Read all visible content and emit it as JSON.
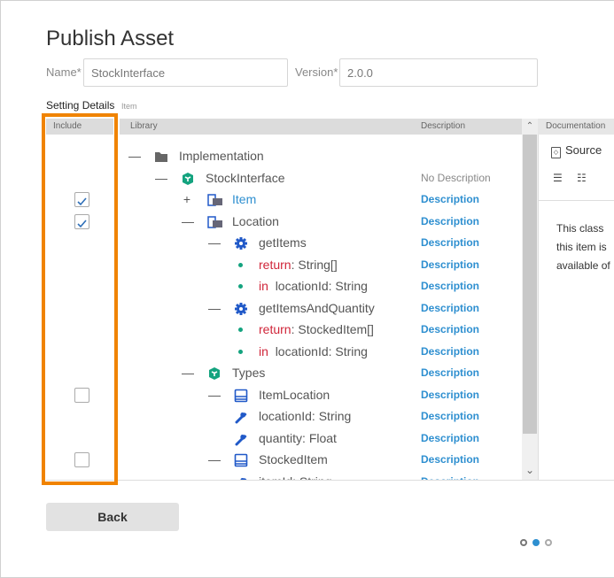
{
  "title": "Publish Asset",
  "form": {
    "name_label": "Name*",
    "name_value": "StockInterface",
    "version_label": "Version*",
    "version_value": "2.0.0"
  },
  "section": {
    "title": "Setting Details",
    "subtitle": "Item"
  },
  "columns": {
    "include": "Include",
    "library": "Library",
    "description": "Description",
    "documentation": "Documentation"
  },
  "tree": [
    {
      "level": 0,
      "toggle": "minus",
      "icon": "folder-icon",
      "label": "Implementation",
      "desc": "",
      "checkbox": null
    },
    {
      "level": 1,
      "toggle": "minus",
      "icon": "package-icon",
      "label": "StockInterface",
      "desc": "No Description",
      "checkbox": null
    },
    {
      "level": 2,
      "toggle": "plus",
      "icon": "class-icon",
      "label": "Item",
      "desc": "Description",
      "checkbox": true,
      "highlight": true
    },
    {
      "level": 2,
      "toggle": "minus",
      "icon": "class-icon",
      "label": "Location",
      "desc": "Description",
      "checkbox": true
    },
    {
      "level": 3,
      "toggle": "minus",
      "icon": "gear-icon",
      "label": "getItems",
      "desc": "Description",
      "checkbox": null
    },
    {
      "level": 4,
      "toggle": "bullet",
      "prefix": "return",
      "label": ": String[]",
      "desc": "Description",
      "checkbox": null
    },
    {
      "level": 4,
      "toggle": "bullet",
      "prefix": "in",
      "label": "locationId: String",
      "desc": "Description",
      "checkbox": null
    },
    {
      "level": 3,
      "toggle": "minus",
      "icon": "gear-icon",
      "label": "getItemsAndQuantity",
      "desc": "Description",
      "checkbox": null
    },
    {
      "level": 4,
      "toggle": "bullet",
      "prefix": "return",
      "label": ": StockedItem[]",
      "desc": "Description",
      "checkbox": null
    },
    {
      "level": 4,
      "toggle": "bullet",
      "prefix": "in",
      "label": "locationId: String",
      "desc": "Description",
      "checkbox": null
    },
    {
      "level": 2,
      "toggle": "minus",
      "icon": "package-icon",
      "label": "Types",
      "desc": "Description",
      "checkbox": null
    },
    {
      "level": 3,
      "toggle": "minus",
      "icon": "struct-icon",
      "label": "ItemLocation",
      "desc": "Description",
      "checkbox": false
    },
    {
      "level": 4,
      "toggle": "none",
      "icon": "wrench-icon",
      "label": "locationId: String",
      "desc": "Description",
      "checkbox": null
    },
    {
      "level": 4,
      "toggle": "none",
      "icon": "wrench-icon",
      "label": "quantity: Float",
      "desc": "Description",
      "checkbox": null
    },
    {
      "level": 3,
      "toggle": "minus",
      "icon": "struct-icon",
      "label": "StockedItem",
      "desc": "Description",
      "checkbox": false
    },
    {
      "level": 4,
      "toggle": "none",
      "icon": "wrench-icon",
      "label": "itemId: String",
      "desc": "Description",
      "checkbox": null
    }
  ],
  "documentation": {
    "source_label": "Source",
    "text_lines": [
      "This class",
      "this item is",
      "available of"
    ]
  },
  "back_label": "Back",
  "pager": {
    "total": 3,
    "active": 1
  },
  "colors": {
    "accent": "#2e8fd0",
    "highlight_border": "#f08300",
    "teal": "#14a37f",
    "keyword": "#d0263a"
  }
}
